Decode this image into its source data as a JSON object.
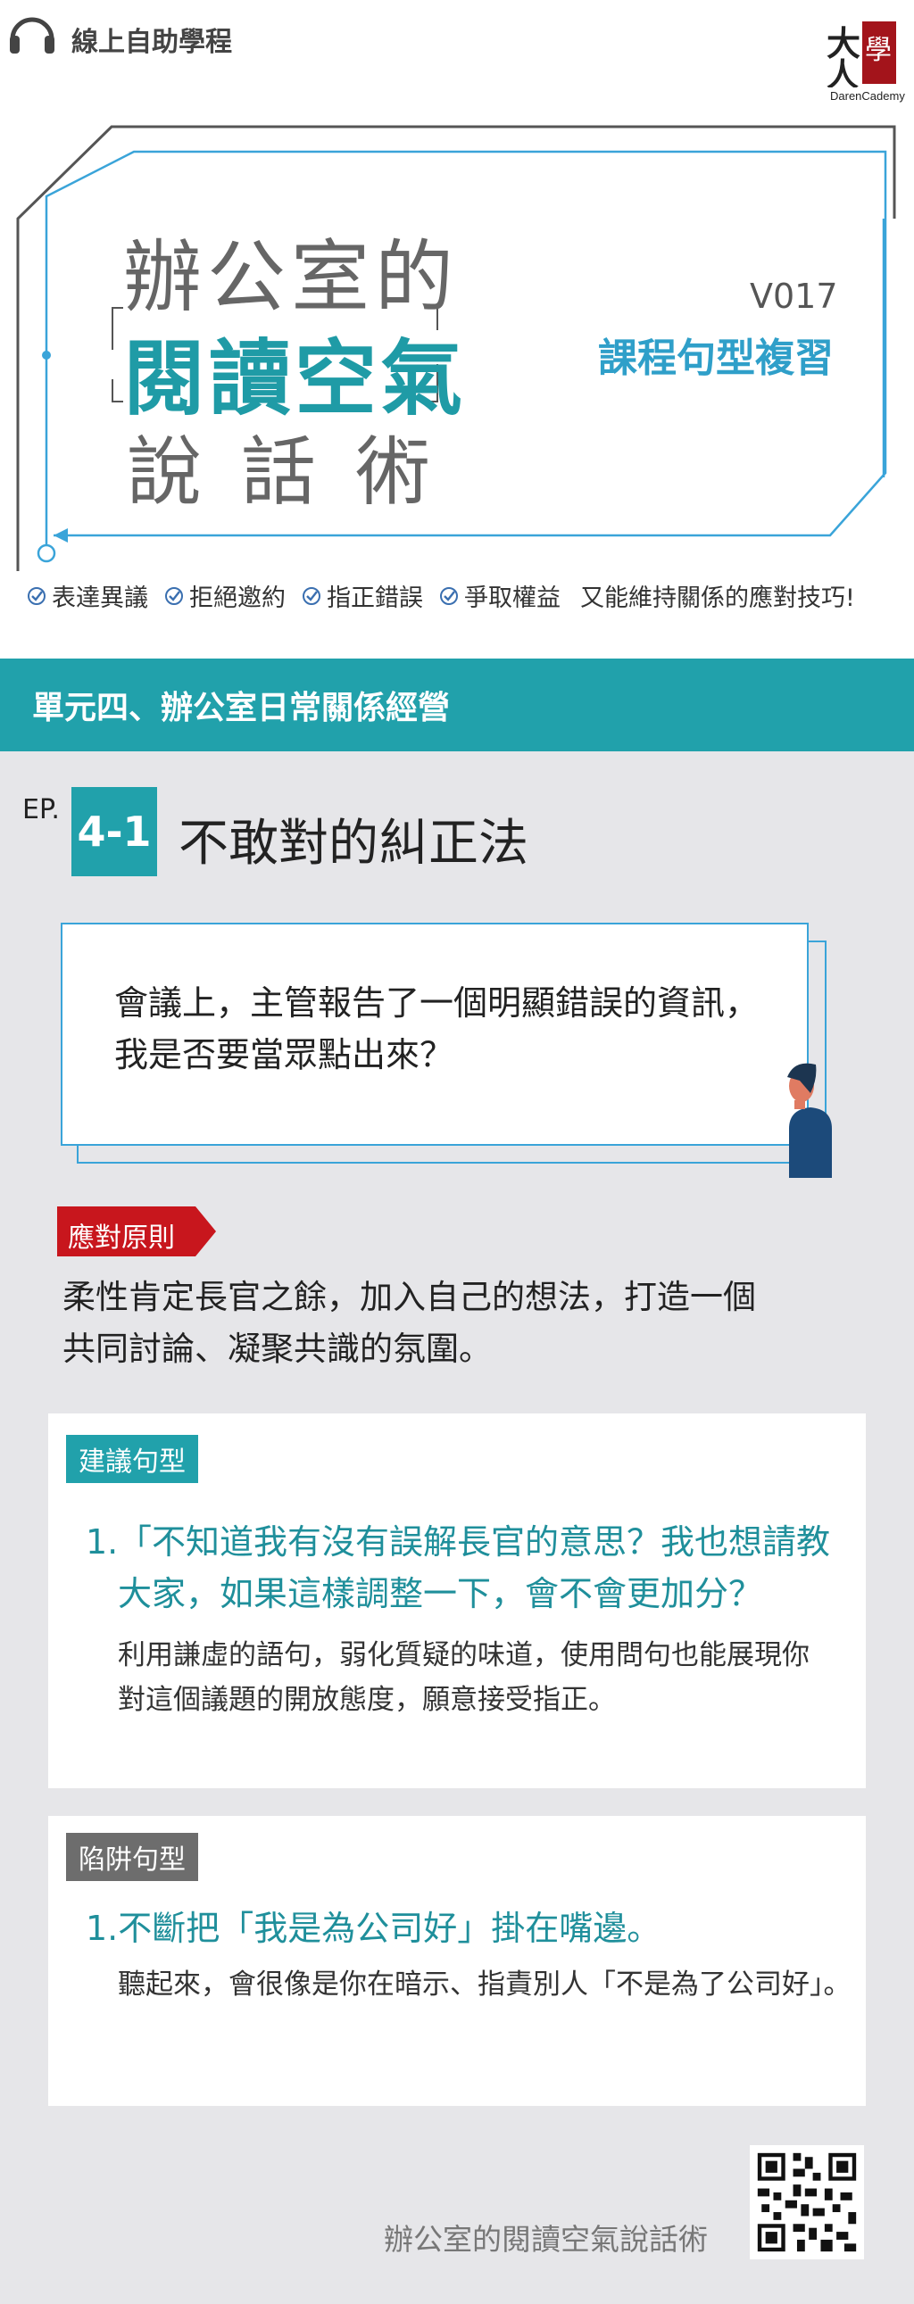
{
  "header": {
    "channel_label": "線上自助學程",
    "logo_brand": "DarenCademy"
  },
  "title": {
    "line1": "辦公室的",
    "line2": "閱讀空氣",
    "line3": "說話術",
    "version": "V017",
    "subtitle": "課程句型複習"
  },
  "checks": {
    "items": [
      "表達異議",
      "拒絕邀約",
      "指正錯誤",
      "爭取權益"
    ],
    "tail": "又能維持關係的應對技巧!"
  },
  "unit": {
    "title": "單元四、辦公室日常關係經營"
  },
  "episode": {
    "prefix": "EP.",
    "number": "4-1",
    "title": "不敢對的糾正法"
  },
  "question": {
    "line1": "會議上，主管報告了一個明顯錯誤的資訊，",
    "line2": "我是否要當眾點出來？"
  },
  "principle": {
    "tag": "應對原則",
    "line1": "柔性肯定長官之餘，加入自己的想法，打造一個",
    "line2": "共同討論、凝聚共識的氛圍。"
  },
  "suggested": {
    "tag": "建議句型",
    "num": "1.",
    "line1": "「不知道我有沒有誤解長官的意思？我也想請教",
    "line2": "大家，如果這樣調整一下，會不會更加分？",
    "explain1": "利用謙虛的語句，弱化質疑的味道，使用問句也能展現你",
    "explain2": "對這個議題的開放態度，願意接受指正。"
  },
  "trap": {
    "tag": "陷阱句型",
    "num": "1.",
    "line1": "不斷把「我是為公司好」掛在嘴邊。",
    "explain1": "聽起來，會很像是你在暗示、指責別人「不是為了公司好」。"
  },
  "footer": {
    "text": "辦公室的閱讀空氣說話術"
  },
  "colors": {
    "teal": "#21a1ab",
    "blue_frame": "#3aa4d9",
    "red_tag": "#c8161d",
    "grey_bg": "#e6e6e9",
    "dark_tag": "#6d6d6d"
  }
}
